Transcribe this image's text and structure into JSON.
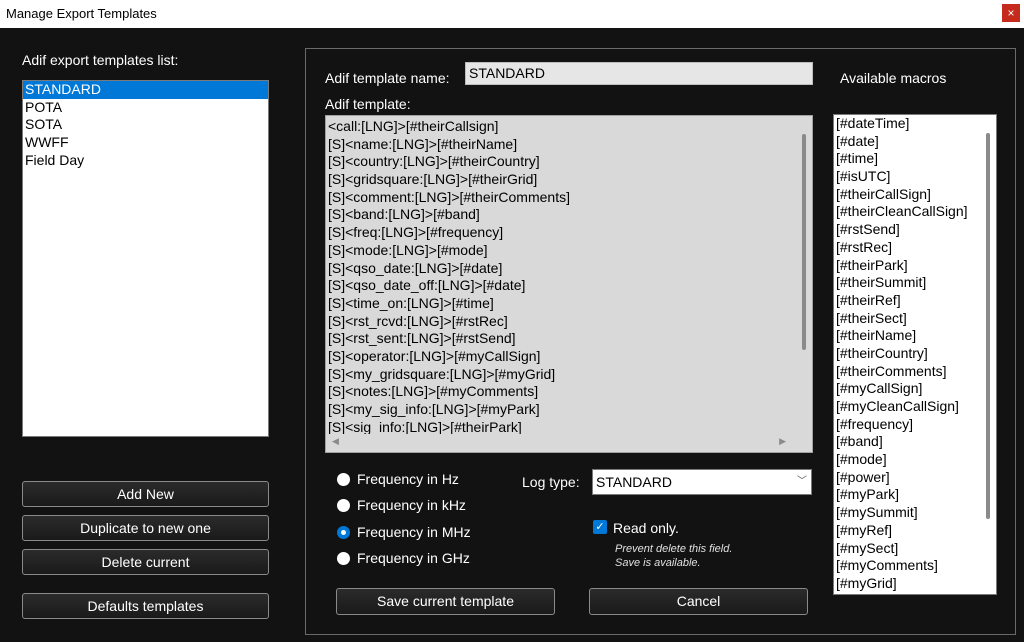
{
  "window": {
    "title": "Manage Export Templates",
    "close_glyph": "×"
  },
  "left": {
    "list_label": "Adif export templates list:",
    "templates": [
      "STANDARD",
      "POTA",
      "SOTA",
      "WWFF",
      "Field Day"
    ],
    "selected_index": 0,
    "buttons": {
      "add_new": "Add New",
      "duplicate": "Duplicate to new one",
      "delete": "Delete current",
      "defaults": "Defaults templates"
    }
  },
  "editor": {
    "name_label": "Adif template name:",
    "name_value": "STANDARD",
    "template_label": "Adif template:",
    "template_lines": [
      "<call:[LNG]>[#theirCallsign]",
      "[S]<name:[LNG]>[#theirName]",
      "[S]<country:[LNG]>[#theirCountry]",
      "[S]<gridsquare:[LNG]>[#theirGrid]",
      "[S]<comment:[LNG]>[#theirComments]",
      "[S]<band:[LNG]>[#band]",
      "[S]<freq:[LNG]>[#frequency]",
      "[S]<mode:[LNG]>[#mode]",
      "[S]<qso_date:[LNG]>[#date]",
      "[S]<qso_date_off:[LNG]>[#date]",
      "[S]<time_on:[LNG]>[#time]",
      "[S]<rst_rcvd:[LNG]>[#rstRec]",
      "[S]<rst_sent:[LNG]>[#rstSend]",
      "[S]<operator:[LNG]>[#myCallSign]",
      "[S]<my_gridsquare:[LNG]>[#myGrid]",
      "[S]<notes:[LNG]>[#myComments]",
      "[S]<my_sig_info:[LNG]>[#myPark]",
      "[S]<sig_info:[LNG]>[#theirPark]"
    ]
  },
  "macros": {
    "label": "Available macros",
    "items": [
      "[#dateTime]",
      "[#date]",
      "[#time]",
      "[#isUTC]",
      "[#theirCallSign]",
      "[#theirCleanCallSign]",
      "[#rstSend]",
      "[#rstRec]",
      "[#theirPark]",
      "[#theirSummit]",
      "[#theirRef]",
      "[#theirSect]",
      "[#theirName]",
      "[#theirCountry]",
      "[#theirComments]",
      "[#myCallSign]",
      "[#myCleanCallSign]",
      "[#frequency]",
      "[#band]",
      "[#mode]",
      "[#power]",
      "[#myPark]",
      "[#mySummit]",
      "[#myRef]",
      "[#mySect]",
      "[#myComments]",
      "[#myGrid]"
    ]
  },
  "frequency": {
    "options": [
      "Frequency in Hz",
      "Frequency in kHz",
      "Frequency in MHz",
      "Frequency in GHz"
    ],
    "selected_index": 2
  },
  "log_type": {
    "label": "Log type:",
    "value": "STANDARD"
  },
  "read_only": {
    "label": "Read only.",
    "checked": true,
    "hint_line1": "Prevent delete this field.",
    "hint_line2": "Save is available."
  },
  "actions": {
    "save": "Save current template",
    "cancel": "Cancel"
  },
  "colors": {
    "accent": "#0078d7",
    "close": "#c42b1c",
    "background": "#121212"
  }
}
